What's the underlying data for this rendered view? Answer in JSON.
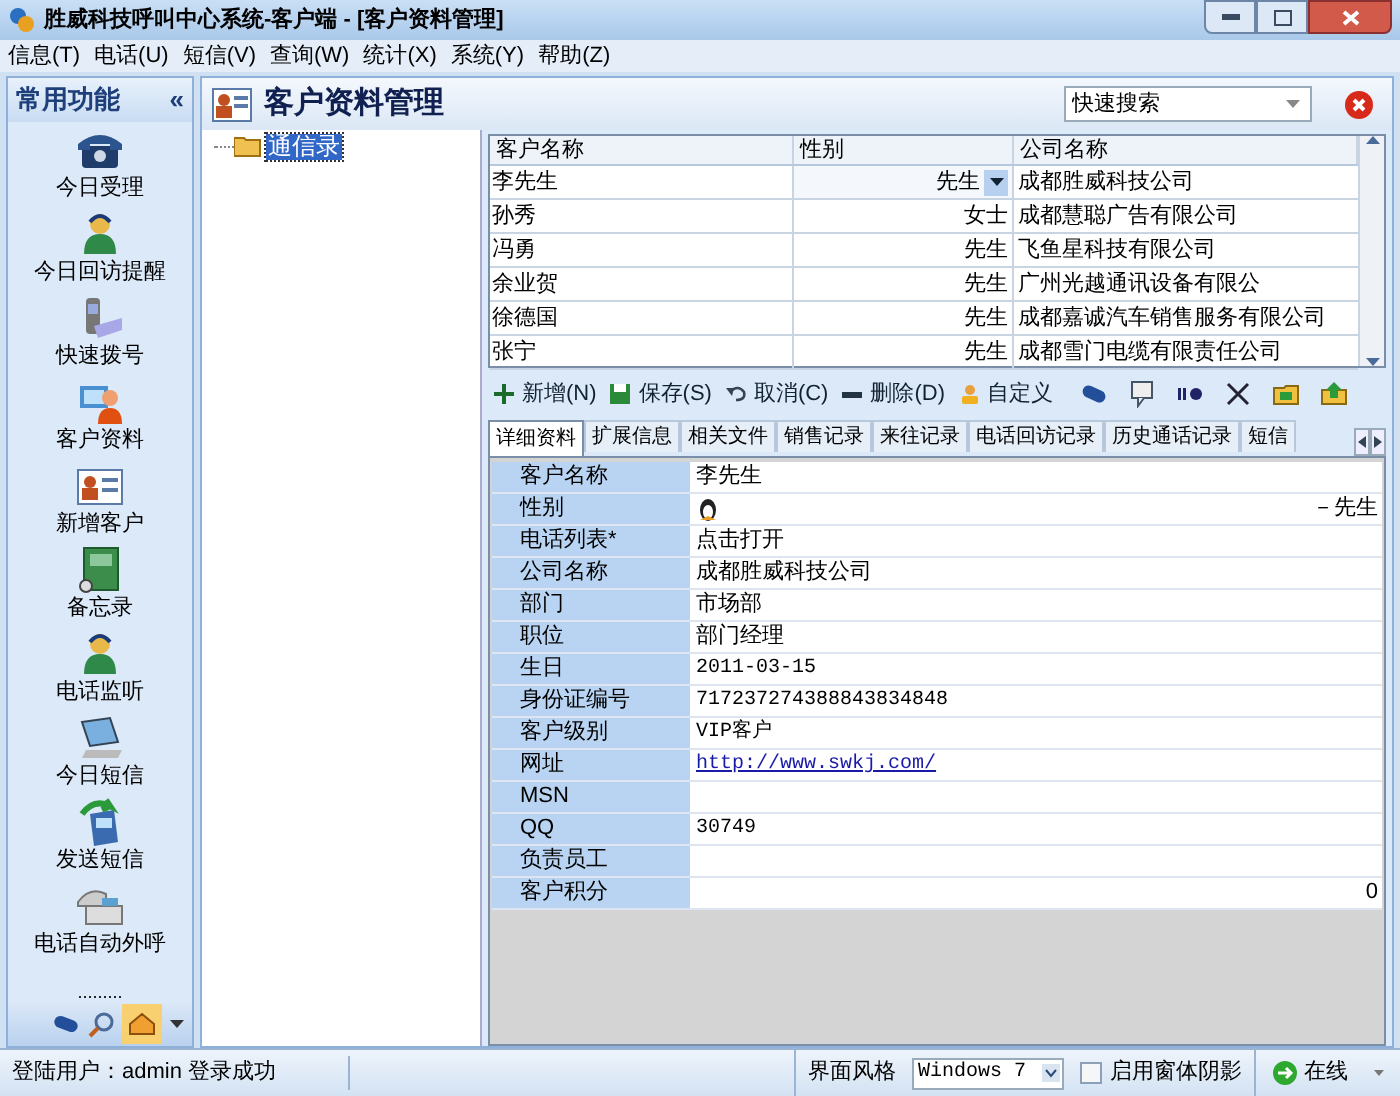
{
  "window": {
    "title": "胜威科技呼叫中心系统-客户端 - [客户资料管理]"
  },
  "menu": [
    "信息(T)",
    "电话(U)",
    "短信(V)",
    "查询(W)",
    "统计(X)",
    "系统(Y)",
    "帮助(Z)"
  ],
  "sidebar": {
    "title": "常用功能",
    "collapse": "«",
    "items": [
      "今日受理",
      "今日回访提醒",
      "快速拨号",
      "客户资料",
      "新增客户",
      "备忘录",
      "电话监听",
      "今日短信",
      "发送短信",
      "电话自动外呼"
    ],
    "more": "........."
  },
  "page": {
    "title": "客户资料管理",
    "search": {
      "placeholder": "快速搜索"
    }
  },
  "tree": {
    "root": "通信录",
    "selected": true
  },
  "grid": {
    "columns": [
      "客户名称",
      "性别",
      "公司名称"
    ],
    "rows": [
      {
        "name": "李先生",
        "gender": "先生",
        "company": "成都胜威科技公司",
        "selected": true
      },
      {
        "name": "孙秀",
        "gender": "女士",
        "company": "成都慧聪广告有限公司",
        "selected": false
      },
      {
        "name": "冯勇",
        "gender": "先生",
        "company": "飞鱼星科技有限公司",
        "selected": false
      },
      {
        "name": "余业贺",
        "gender": "先生",
        "company": "广州光越通讯设备有限公",
        "selected": false
      },
      {
        "name": "徐德国",
        "gender": "先生",
        "company": "成都嘉诚汽车销售服务有限公司",
        "selected": false
      },
      {
        "name": "张宁",
        "gender": "先生",
        "company": "成都雪门电缆有限责任公司",
        "selected": false
      }
    ]
  },
  "toolbar": [
    "新增(N)",
    "保存(S)",
    "取消(C)",
    "删除(D)",
    "自定义"
  ],
  "tabs": [
    {
      "label": "详细资料",
      "selected": true
    },
    {
      "label": "扩展信息",
      "selected": false
    },
    {
      "label": "相关文件",
      "selected": false
    },
    {
      "label": "销售记录",
      "selected": false
    },
    {
      "label": "来往记录",
      "selected": false
    },
    {
      "label": "电话回访记录",
      "selected": false
    },
    {
      "label": "历史通话记录",
      "selected": false
    },
    {
      "label": "短信",
      "selected": false
    }
  ],
  "details": [
    {
      "label": "客户名称",
      "value": "李先生",
      "kind": "text"
    },
    {
      "label": "性别",
      "value": "－先生",
      "kind": "gender"
    },
    {
      "label": "电话列表*",
      "value": "点击打开",
      "kind": "text"
    },
    {
      "label": "公司名称",
      "value": "成都胜威科技公司",
      "kind": "text"
    },
    {
      "label": "部门",
      "value": "市场部",
      "kind": "text"
    },
    {
      "label": "职位",
      "value": "部门经理",
      "kind": "text"
    },
    {
      "label": "生日",
      "value": "2011-03-15",
      "kind": "text"
    },
    {
      "label": "身份证编号",
      "value": "717237274388843834848",
      "kind": "text"
    },
    {
      "label": "客户级别",
      "value": "VIP客户",
      "kind": "text"
    },
    {
      "label": "网址",
      "value": "http://www.swkj.com/",
      "kind": "link"
    },
    {
      "label": "MSN",
      "kind": "text"
    },
    {
      "label": "QQ",
      "value": "30749",
      "kind": "text"
    },
    {
      "label": "负责员工",
      "kind": "text"
    },
    {
      "label": "客户积分",
      "value": "0",
      "kind": "number"
    }
  ],
  "status_bar": {
    "user": "登陆用户：admin 登录成功",
    "theme_label": "界面风格",
    "theme": "Windows 7",
    "shadow": {
      "label": "启用窗体阴影",
      "checked": false
    },
    "online": "在线"
  }
}
